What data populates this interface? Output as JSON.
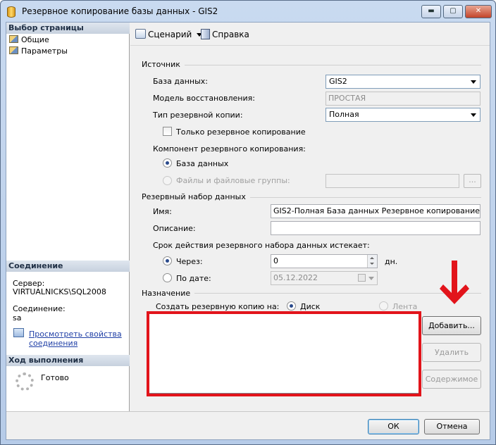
{
  "window": {
    "title": "Резервное копирование базы данных - GIS2",
    "minimize": "▬",
    "maximize": "▢",
    "close": "✕"
  },
  "left": {
    "select_page_header": "Выбор страницы",
    "nav": [
      {
        "label": "Общие",
        "icon": "page-icon"
      },
      {
        "label": "Параметры",
        "icon": "page-icon"
      }
    ],
    "connection_header": "Соединение",
    "server_label": "Сервер:",
    "server_value": "VIRTUALNICKS\\SQL2008",
    "connection_label": "Соединение:",
    "connection_value": "sa",
    "view_props_line1": "Просмотреть свойства",
    "view_props_line2": "соединения",
    "progress_header": "Ход выполнения",
    "progress_status": "Готово"
  },
  "toolbar": {
    "script_label": "Сценарий",
    "help_label": "Справка"
  },
  "source": {
    "group_title": "Источник",
    "database_label": "База данных:",
    "database_value": "GIS2",
    "recovery_label": "Модель восстановления:",
    "recovery_value": "ПРОСТАЯ",
    "backup_type_label": "Тип резервной копии:",
    "backup_type_value": "Полная",
    "copy_only_label": "Только резервное копирование",
    "copy_only_checked": false,
    "component_label": "Компонент резервного копирования:",
    "component_database": "База данных",
    "component_files": "Файлы и файловые группы:",
    "browse_label": "..."
  },
  "backup_set": {
    "group_title": "Резервный набор данных",
    "name_label": "Имя:",
    "name_value": "GIS2-Полная База данных Резервное копирование",
    "description_label": "Описание:",
    "description_value": "",
    "expires_label": "Срок действия резервного набора данных истекает:",
    "after_label": "Через:",
    "after_value": "0",
    "days_label": "дн.",
    "on_label": "По дате:",
    "on_value": "05.12.2022"
  },
  "destination": {
    "group_title": "Назначение",
    "backup_to_label": "Создать резервную копию на:",
    "disk_label": "Диск",
    "tape_label": "Лента",
    "add_label": "Добавить...",
    "remove_label": "Удалить",
    "contents_label": "Содержимое"
  },
  "footer": {
    "ok_label": "ОК",
    "cancel_label": "Отмена"
  },
  "colors": {
    "highlight_frame": "#e2141b",
    "arrow": "#e2141b",
    "link": "#1f3fa6"
  }
}
